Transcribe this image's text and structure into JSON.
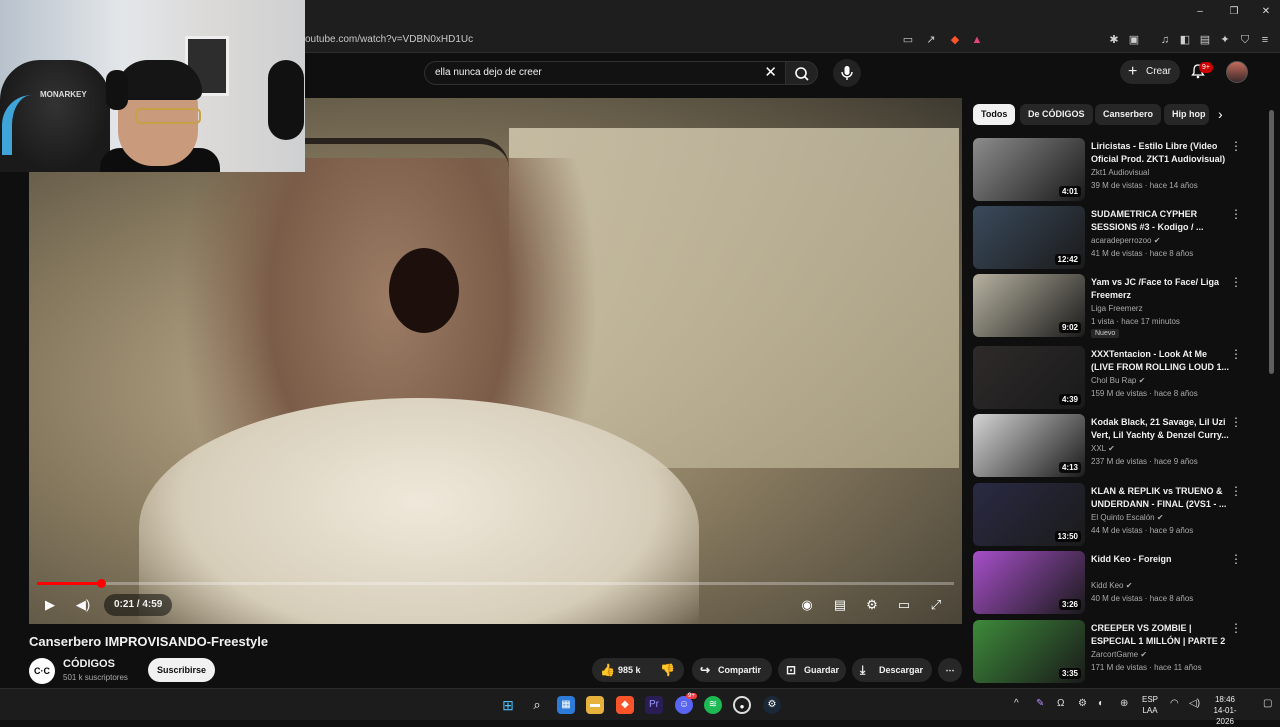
{
  "browser": {
    "url": "outube.com/watch?v=VDBN0xHD1Uc",
    "window_controls": [
      "–",
      "❐",
      "✕"
    ]
  },
  "header": {
    "search_value": "ella nunca dejo de creer",
    "create_label": "Crear",
    "notification_count": "9+"
  },
  "player": {
    "time": "0:21 / 4:59",
    "progress": 0.07
  },
  "video": {
    "title": "Canserbero IMPROVISANDO-Freestyle",
    "channel_name": "CÓDIGOS",
    "channel_avatar_text": "C·C",
    "subscribers": "501 k suscriptores",
    "subscribe_label": "Suscribirse",
    "likes": "985 k",
    "share_label": "Compartir",
    "save_label": "Guardar",
    "download_label": "Descargar"
  },
  "chips": [
    "Todos",
    "De CÓDIGOS",
    "Canserbero",
    "Hip hop"
  ],
  "recommendations": [
    {
      "title": "Liricistas - Estilo Libre (Video Oficial Prod. ZKT1 Audiovisual)",
      "channel": "Zkt1 Audiovisual",
      "meta": "39 M de vistas · hace 14 años",
      "duration": "4:01",
      "verified": false,
      "color": "#8c8c8c"
    },
    {
      "title": "SUDAMETRICA CYPHER SESSIONS #3 - Kodigo / ...",
      "channel": "acaradeperrozoo",
      "meta": "41 M de vistas · hace 8 años",
      "duration": "12:42",
      "verified": true,
      "color": "#3a4a5c"
    },
    {
      "title": "Yam vs JC /Face to Face/ Liga Freemerz",
      "channel": "Liga Freemerz",
      "meta": "1 vista · hace 17 minutos",
      "duration": "9:02",
      "verified": false,
      "badge": "Nuevo",
      "color": "#b7b2a0"
    },
    {
      "title": "XXXTentacion - Look At Me (LIVE FROM ROLLING LOUD 1...",
      "channel": "Chol Bu Rap",
      "meta": "159 M de vistas · hace 8 años",
      "duration": "4:39",
      "verified": true,
      "color": "#2e2a2a"
    },
    {
      "title": "Kodak Black, 21 Savage, Lil Uzi Vert, Lil Yachty & Denzel Curry...",
      "channel": "XXL",
      "meta": "237 M de vistas · hace 9 años",
      "duration": "4:13",
      "verified": true,
      "color": "#d4d4d4"
    },
    {
      "title": "KLAN & REPLIK vs TRUENO & UNDERDANN - FINAL (2VS1 - ...",
      "channel": "El Quinto Escalón",
      "meta": "44 M de vistas · hace 9 años",
      "duration": "13:50",
      "verified": true,
      "color": "#2a2a44"
    },
    {
      "title": "Kidd Keo - Foreign",
      "channel": "Kidd Keo",
      "meta": "40 M de vistas · hace 8 años",
      "duration": "3:26",
      "verified": true,
      "color": "#a64fc9"
    },
    {
      "title": "CREEPER VS ZOMBIE | ESPECIAL 1 MILLÓN | PARTE 2",
      "channel": "ZarcortGame",
      "meta": "171 M de vistas · hace 11 años",
      "duration": "3:35",
      "verified": true,
      "color": "#3d8a3a"
    }
  ],
  "webcam": {
    "chair_brand": "MONARKEY"
  },
  "taskbar": {
    "lang_top": "ESP",
    "lang_bottom": "LAA",
    "time": "18:46",
    "date": "14-01-2026",
    "discord_badge": "9+"
  }
}
